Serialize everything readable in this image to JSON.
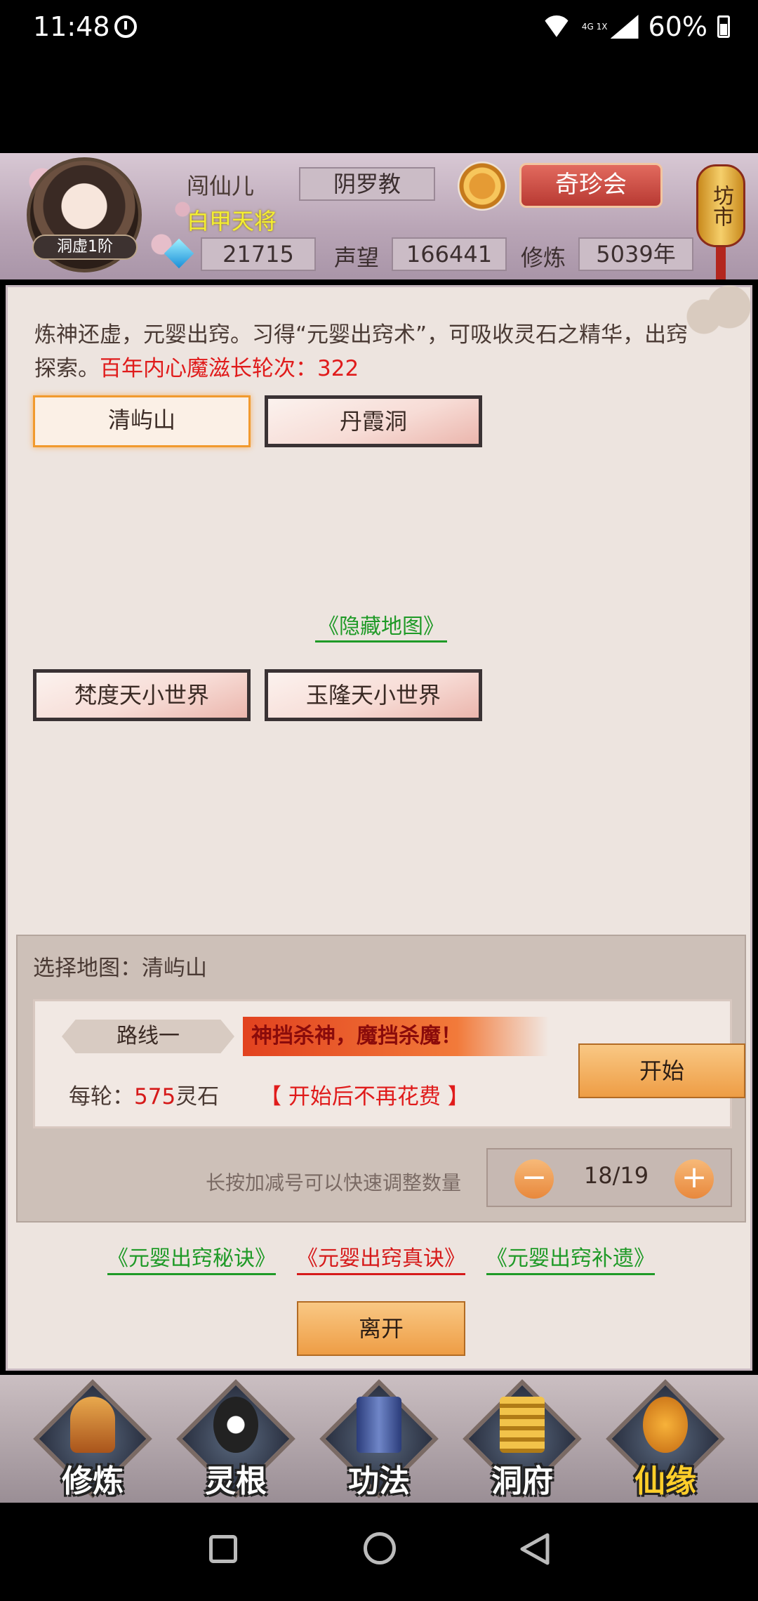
{
  "status_bar": {
    "time": "11:48",
    "battery": "60%",
    "net": "4G 1X"
  },
  "header": {
    "player_name": "闯仙儿",
    "player_title": "白甲天将",
    "rank": "洞虚1阶",
    "sect": "阴罗教",
    "qizhen_label": "奇珍会",
    "fangshi_label": "坊市",
    "spirit_stones": "21715",
    "reputation_label": "声望",
    "reputation": "166441",
    "cultivation_label": "修炼",
    "cultivation": "5039年"
  },
  "main": {
    "intro_text": "炼神还虚，元婴出窍。习得“元婴出窍术”，可吸收灵石之精华，出窍探索。",
    "intro_red": "百年内心魔滋长轮次：322",
    "maps_top": [
      "清屿山",
      "丹霞洞"
    ],
    "hidden_map": "《隐藏地图》",
    "maps_hidden": [
      "梵度天小世界",
      "玉隆天小世界"
    ]
  },
  "config": {
    "select_map": "选择地图：清屿山",
    "route_label": "路线一",
    "route_slogan": "神挡杀神，魔挡杀魔！",
    "cost_prefix": "每轮：",
    "cost_value": "575",
    "cost_suffix": "灵石",
    "no_more_cost": "【 开始后不再花费 】",
    "start_label": "开始",
    "hint": "长按加减号可以快速调整数量",
    "minus": "−",
    "plus": "+",
    "count": "18/19"
  },
  "links": [
    "《元婴出窍秘诀》",
    "《元婴出窍真诀》",
    "《元婴出窍补遗》"
  ],
  "leave_label": "离开",
  "bottom_nav": [
    "修炼",
    "灵根",
    "功法",
    "洞府",
    "仙缘"
  ],
  "colors": {
    "accent_red": "#e01b1b",
    "link_green": "#1f9a27",
    "button_orange": "#ee9d45"
  }
}
